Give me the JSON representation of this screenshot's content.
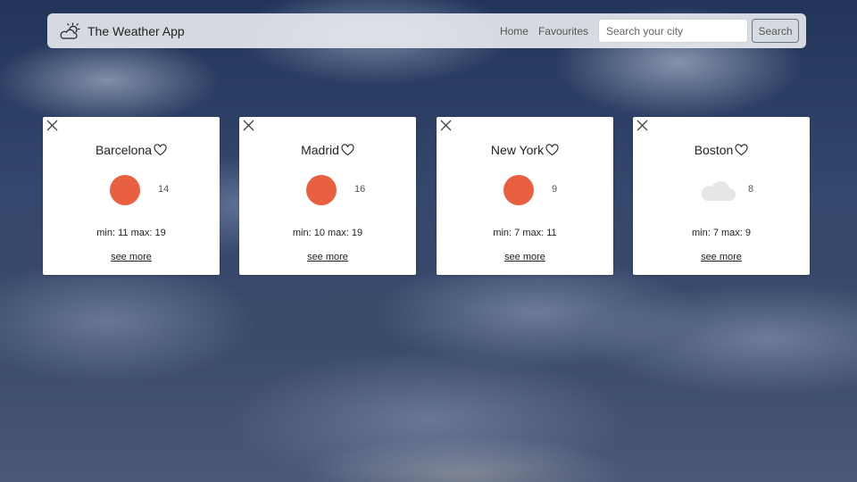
{
  "app": {
    "title": "The Weather App",
    "logo_icon": "sun-behind-cloud-icon"
  },
  "nav": {
    "home": "Home",
    "favourites": "Favourites"
  },
  "search": {
    "placeholder": "Search your city",
    "value": "",
    "button_label": "Search"
  },
  "cards": [
    {
      "city": "Barcelona",
      "icon": "sun-icon",
      "icon_color": "#e8603f",
      "temp": "14",
      "minmax": "min: 11 max: 19",
      "link": "see more"
    },
    {
      "city": "Madrid",
      "icon": "sun-icon",
      "icon_color": "#e8603f",
      "temp": "16",
      "minmax": "min: 10 max: 19",
      "link": "see more"
    },
    {
      "city": "New York",
      "icon": "sun-icon",
      "icon_color": "#e8603f",
      "temp": "9",
      "minmax": "min: 7 max: 11",
      "link": "see more"
    },
    {
      "city": "Boston",
      "icon": "cloud-icon",
      "icon_color": "#e5e5e5",
      "temp": "8",
      "minmax": "min: 7 max: 9",
      "link": "see more"
    }
  ]
}
